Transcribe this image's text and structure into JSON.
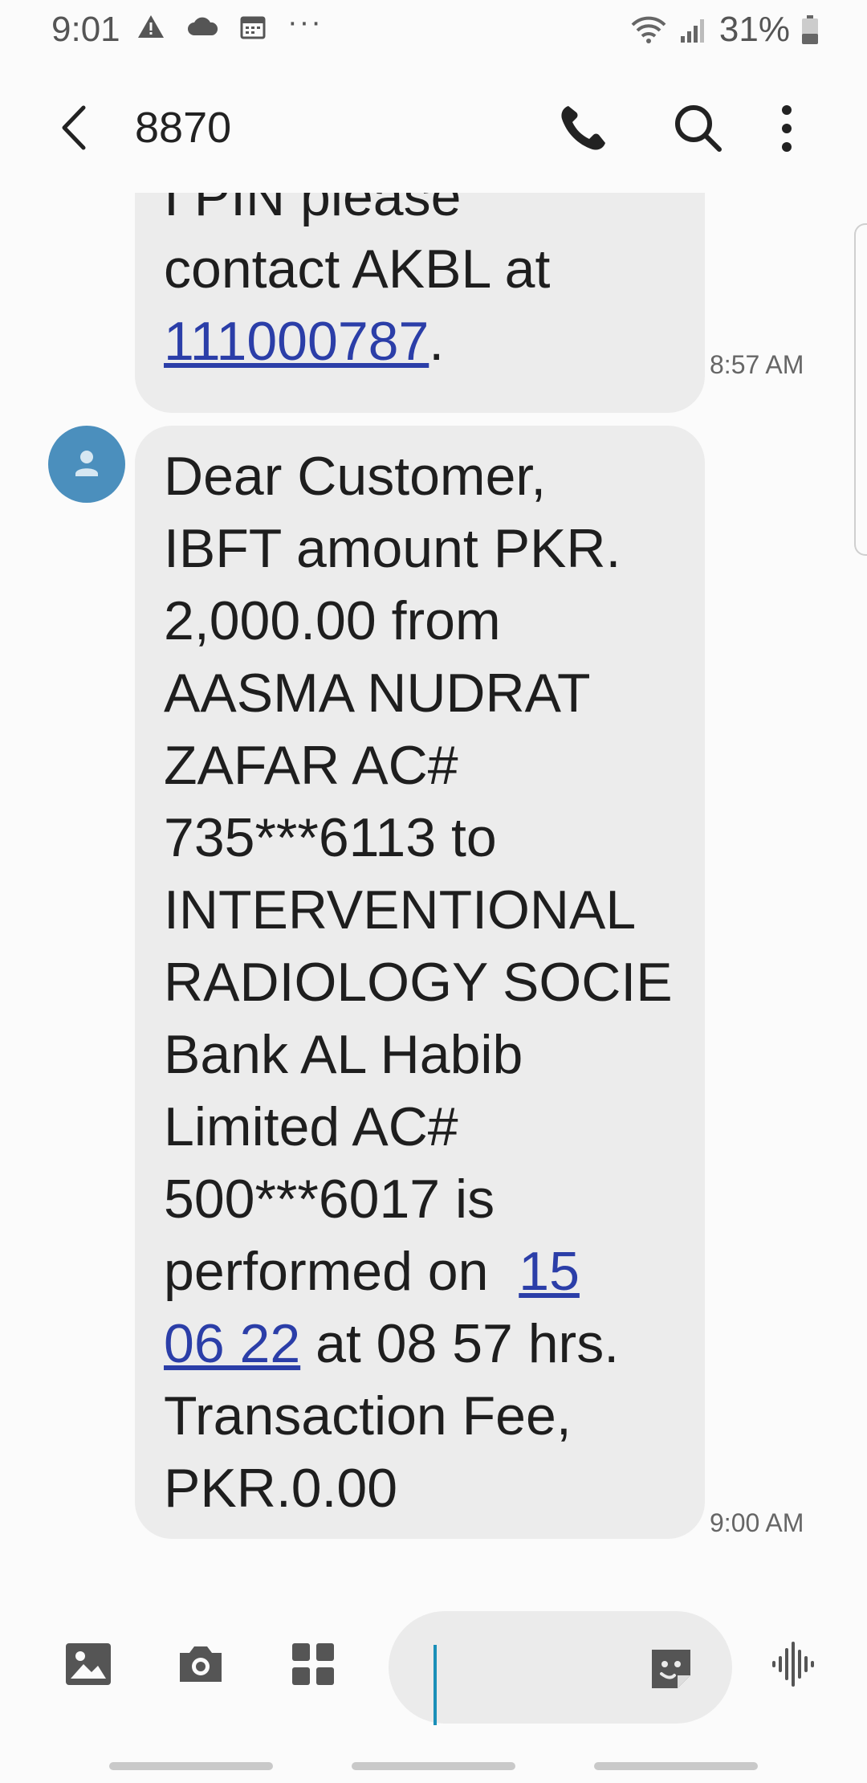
{
  "status_bar": {
    "time": "9:01",
    "battery": "31%"
  },
  "header": {
    "contact": "8870"
  },
  "messages": [
    {
      "lines_before_link": [
        "I PIN please",
        "contact AKBL at"
      ],
      "link": "111000787",
      "after_link": ".",
      "time": "8:57 AM"
    },
    {
      "lines": [
        "Dear Customer,",
        "IBFT amount PKR.",
        "2,000.00 from",
        "AASMA NUDRAT",
        "ZAFAR AC#",
        "735***6113 to",
        "INTERVENTIONAL",
        "RADIOLOGY SOCIE",
        "Bank AL Habib",
        "Limited AC#",
        "500***6017 is"
      ],
      "performed_prefix": "performed on ",
      "date_link_1": "15",
      "date_link_2": "06 22",
      "after_date": " at 08 57 hrs.",
      "fee_line_1": "Transaction Fee,",
      "fee_line_2": "PKR.0.00",
      "time": "9:00 AM"
    }
  ],
  "colors": {
    "bubble": "#ececec",
    "link": "#2b3ea8",
    "avatar": "#4b8fbd",
    "caret": "#1a8fb8"
  }
}
